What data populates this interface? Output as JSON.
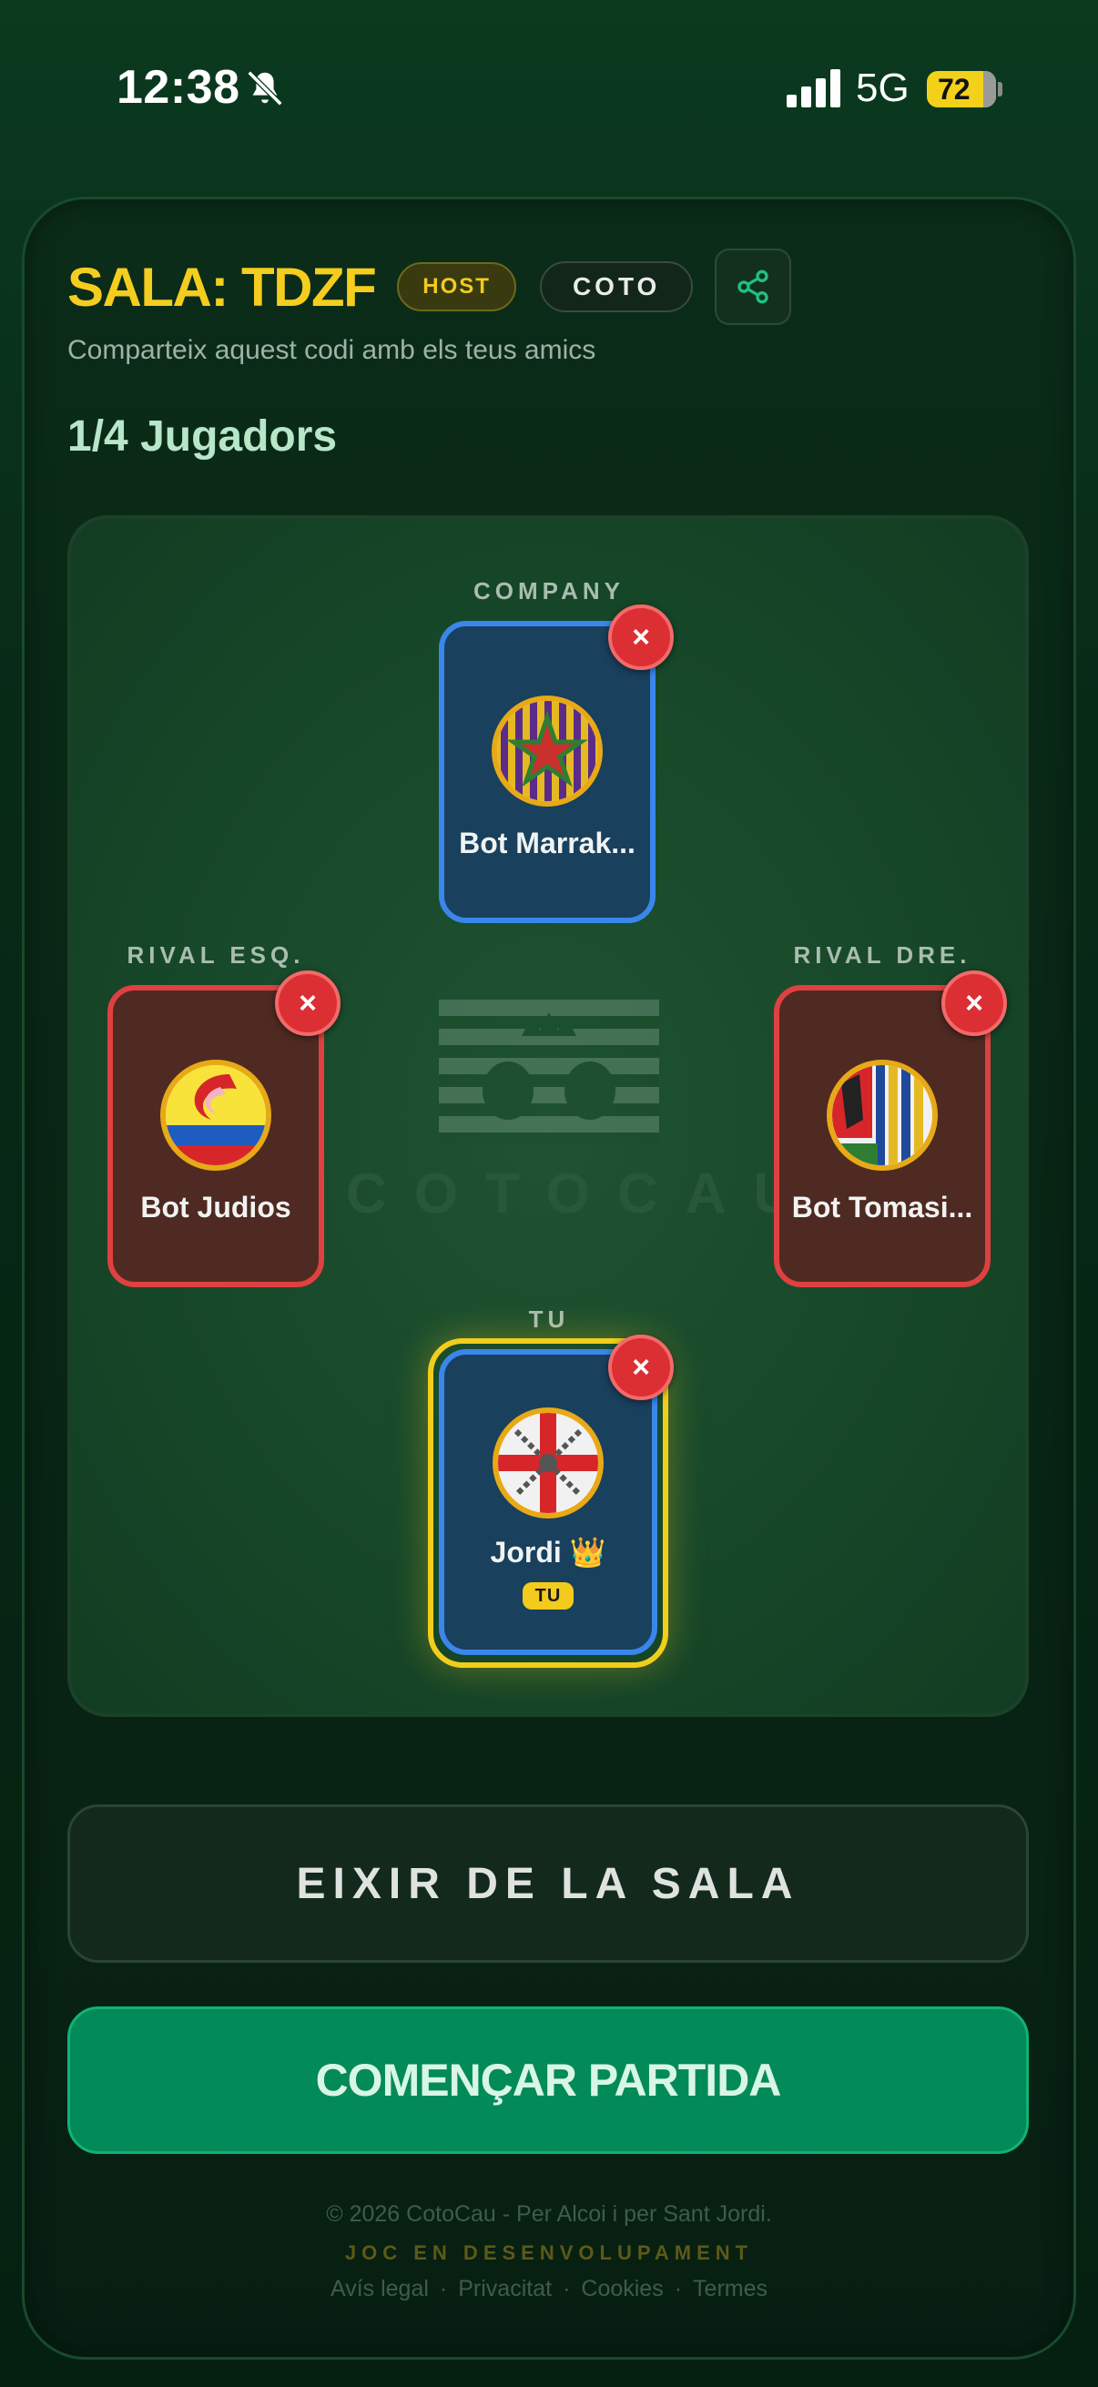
{
  "status_bar": {
    "time": "12:38",
    "network": "5G",
    "battery": "72",
    "icons": [
      "bell-slash-icon",
      "signal-icon",
      "battery-icon"
    ]
  },
  "header": {
    "room_title": "SALA: TDZF",
    "host_badge": "HOST",
    "game_badge": "COTO",
    "share_icon": "share-icon",
    "subtitle": "Comparteix aquest codi amb els teus amics",
    "players_count": "1/4 Jugadors"
  },
  "table": {
    "watermark": "COTOCAU",
    "seats": {
      "top": {
        "label": "COMPANY",
        "name": "Bot Marrak...",
        "team": "blue"
      },
      "left": {
        "label": "RIVAL ESQ.",
        "name": "Bot Judios",
        "team": "red"
      },
      "right": {
        "label": "RIVAL DRE.",
        "name": "Bot Tomasi...",
        "team": "red"
      },
      "bottom": {
        "label": "TU",
        "name": "Jordi 👑",
        "badge": "TU",
        "team": "blue"
      }
    },
    "remove_glyph": "×"
  },
  "actions": {
    "leave": "EIXIR DE LA SALA",
    "start": "COMENÇAR PARTIDA"
  },
  "footer": {
    "copyright": "© 2026 CotoCau - Per Alcoi i per Sant Jordi.",
    "dev_notice": "JOC EN DESENVOLUPAMENT",
    "links": [
      "Avís legal",
      "Privacitat",
      "Cookies",
      "Termes"
    ],
    "separator": "·"
  },
  "colors": {
    "accent_yellow": "#f5cd1f",
    "team_blue": "#3a86ea",
    "team_red": "#df4041",
    "start_green": "#038a59"
  }
}
